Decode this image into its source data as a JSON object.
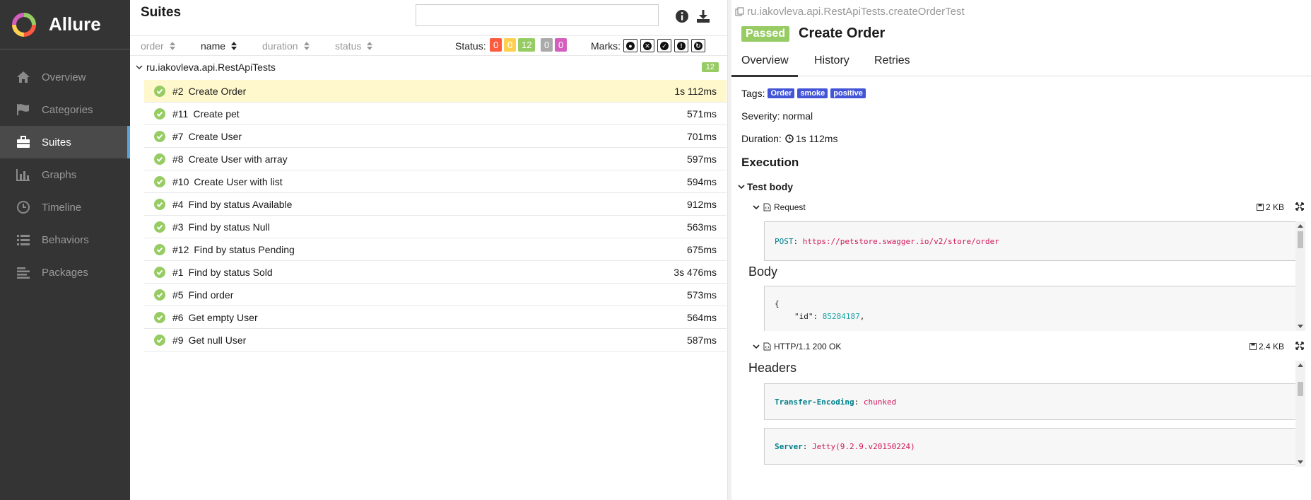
{
  "brand": {
    "name": "Allure"
  },
  "sidebar": {
    "items": [
      {
        "label": "Overview",
        "icon": "home-icon"
      },
      {
        "label": "Categories",
        "icon": "flag-icon"
      },
      {
        "label": "Suites",
        "icon": "briefcase-icon",
        "active": true
      },
      {
        "label": "Graphs",
        "icon": "bar-chart-icon"
      },
      {
        "label": "Timeline",
        "icon": "clock-icon"
      },
      {
        "label": "Behaviors",
        "icon": "list-icon"
      },
      {
        "label": "Packages",
        "icon": "align-left-icon"
      }
    ]
  },
  "suites": {
    "title": "Suites",
    "search_value": "",
    "sort": {
      "order": "order",
      "name": "name",
      "duration": "duration",
      "status": "status"
    },
    "status_label": "Status:",
    "status_counts": [
      {
        "value": "0",
        "color": "#fd5a3e"
      },
      {
        "value": "0",
        "color": "#ffd050"
      },
      {
        "value": "12",
        "color": "#97cc64"
      },
      {
        "value": "0",
        "color": "#aaaaaa"
      },
      {
        "value": "0",
        "color": "#d35ebe"
      }
    ],
    "marks_label": "Marks:",
    "group": {
      "name": "ru.iakovleva.api.RestApiTests",
      "count": "12"
    },
    "rows": [
      {
        "num": "#2",
        "name": "Create Order",
        "duration": "1s 112ms"
      },
      {
        "num": "#11",
        "name": "Create pet",
        "duration": "571ms"
      },
      {
        "num": "#7",
        "name": "Create User",
        "duration": "701ms"
      },
      {
        "num": "#8",
        "name": "Create User with array",
        "duration": "597ms"
      },
      {
        "num": "#10",
        "name": "Create User with list",
        "duration": "594ms"
      },
      {
        "num": "#4",
        "name": "Find by status Available",
        "duration": "912ms"
      },
      {
        "num": "#3",
        "name": "Find by status Null",
        "duration": "563ms"
      },
      {
        "num": "#12",
        "name": "Find by status Pending",
        "duration": "675ms"
      },
      {
        "num": "#1",
        "name": "Find by status Sold",
        "duration": "3s 476ms"
      },
      {
        "num": "#5",
        "name": "Find order",
        "duration": "573ms"
      },
      {
        "num": "#6",
        "name": "Get empty User",
        "duration": "564ms"
      },
      {
        "num": "#9",
        "name": "Get null User",
        "duration": "587ms"
      }
    ]
  },
  "detail": {
    "breadcrumb": "ru.iakovleva.api.RestApiTests.createOrderTest",
    "status": "Passed",
    "title": "Create Order",
    "tabs": [
      "Overview",
      "History",
      "Retries"
    ],
    "tags_label": "Tags:",
    "tags": [
      "Order",
      "smoke",
      "positive"
    ],
    "severity": "Severity: normal",
    "duration_label": "Duration:",
    "duration_value": "1s 112ms",
    "execution": "Execution",
    "test_body": "Test body",
    "request": {
      "title": "Request",
      "size": "2 KB",
      "method": "POST",
      "url": "https://petstore.swagger.io/v2/store/order",
      "body_heading": "Body",
      "body_open": "{",
      "body_key": "\"id\"",
      "body_value": "85284187"
    },
    "response": {
      "title": "HTTP/1.1 200 OK",
      "size": "2.4 KB",
      "headers_heading": "Headers",
      "headers": [
        {
          "key": "Transfer-Encoding",
          "value": "chunked"
        },
        {
          "key": "Server",
          "value": "Jetty(9.2.9.v20150224)"
        }
      ]
    }
  }
}
